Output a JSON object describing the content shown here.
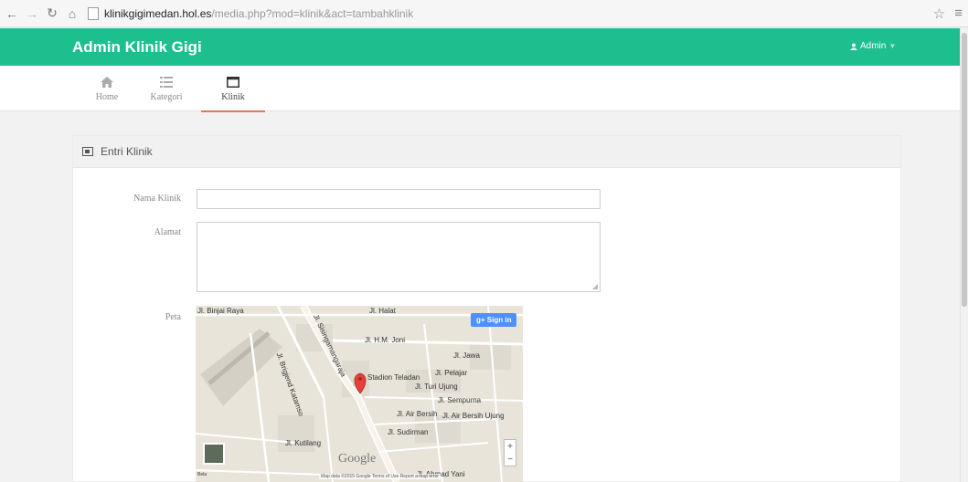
{
  "browser": {
    "url_host": "klinikgigimedan.hol.es",
    "url_path": "/media.php?mod=klinik&act=tambahklinik"
  },
  "navbar": {
    "brand": "Admin Klinik Gigi",
    "user_label": "Admin",
    "accent": "#1dbf8f"
  },
  "tabs": [
    {
      "label": "Home",
      "icon": "home-icon",
      "active": false
    },
    {
      "label": "Kategori",
      "icon": "list-icon",
      "active": false
    },
    {
      "label": "Klinik",
      "icon": "window-icon",
      "active": true
    }
  ],
  "widget": {
    "title": "Entri Klinik"
  },
  "form": {
    "nama_label": "Nama Klinik",
    "nama_value": "",
    "alamat_label": "Alamat",
    "alamat_value": "",
    "peta_label": "Peta"
  },
  "map": {
    "signin": "Sign in",
    "labels": {
      "l1": "Jl. Binjai Raya",
      "l2": "Jl. Halat",
      "l3": "Jl. H.M. Joni",
      "l4": "Jl. Jawa",
      "l5": "Jl. Pelajar",
      "l6": "Jl. Turi Ujung",
      "l7": "Jl. Sempurna",
      "l8": "Jl. Air Bersih",
      "l9": "Jl. Air Bersih Ujung",
      "l10": "Jl. Sisingamangaraja",
      "l11": "Jl. Sudirman",
      "l12": "Stadion Teladan",
      "l13": "Jl. Brigjend Katamso",
      "l14": "Jl. Ahmad Yani",
      "l15": "Jl. Kutilang"
    },
    "google": "Google",
    "footer": "Map data ©2015 Google  Terms of Use  Report a map error",
    "bottom_left": "Bela",
    "zoom_in": "+",
    "zoom_out": "−"
  }
}
